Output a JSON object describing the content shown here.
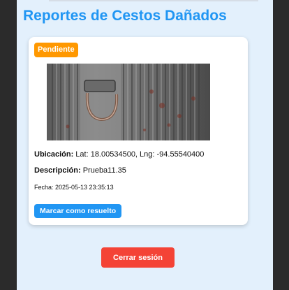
{
  "page": {
    "title": "Reportes de Cestos Dañados"
  },
  "report": {
    "status_badge": "Pendiente",
    "status_color": "#ff9800",
    "location_label": "Ubicación:",
    "location_value": "Lat: 18.00534500, Lng: -94.55540400",
    "description_label": "Descripción:",
    "description_value": "Prueba11.35",
    "date_text": "Fecha: 2025-05-13 23:35:13",
    "resolve_button": "Marcar como resuelto"
  },
  "actions": {
    "logout_button": "Cerrar sesión"
  },
  "colors": {
    "accent": "#2196f3",
    "danger": "#f44336",
    "background": "#e3f0fc"
  }
}
